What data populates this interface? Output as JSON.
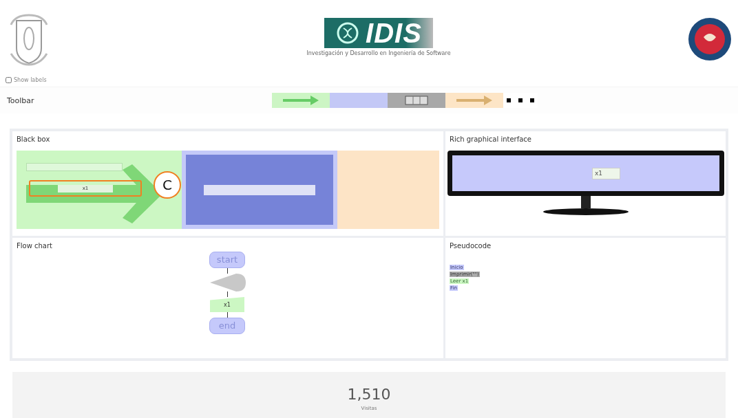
{
  "header": {
    "logo_text": "IDIS",
    "logo_subtitle": "Investigación y Desarrollo en Ingeniería de Software"
  },
  "show_labels": {
    "label": "Show labels",
    "checked": false
  },
  "toolbar": {
    "label": "Toolbar",
    "tools": [
      {
        "kind": "input"
      },
      {
        "kind": "process"
      },
      {
        "kind": "memory"
      },
      {
        "kind": "output"
      },
      {
        "kind": "more"
      }
    ]
  },
  "black_box": {
    "title": "Black box",
    "input_value": "x1",
    "annotation": "C"
  },
  "rich_interface": {
    "title": "Rich graphical interface",
    "field_value": "x1"
  },
  "flow_chart": {
    "title": "Flow chart",
    "nodes": [
      {
        "kind": "terminal",
        "text": "start"
      },
      {
        "kind": "output"
      },
      {
        "kind": "input",
        "text": "x1"
      },
      {
        "kind": "terminal",
        "text": "end"
      }
    ]
  },
  "pseudocode": {
    "title": "Pseudocode",
    "lines": [
      {
        "kind": "start",
        "text": "Inicio"
      },
      {
        "kind": "output",
        "text": "Imprimir(\"\")"
      },
      {
        "kind": "input",
        "text": "Leer x1"
      },
      {
        "kind": "end",
        "text": "Fin"
      }
    ]
  },
  "footer": {
    "count": "1,510",
    "label": "Visitas"
  }
}
